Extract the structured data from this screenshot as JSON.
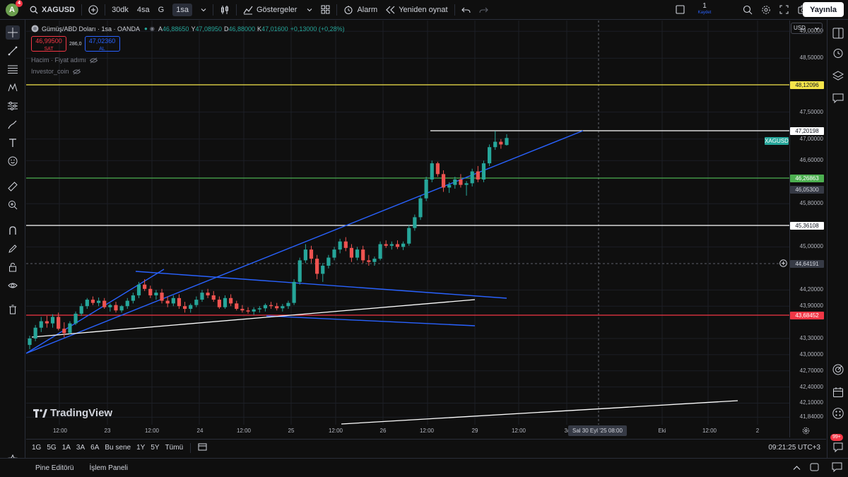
{
  "topbar": {
    "avatar_letter": "A",
    "avatar_badge": "4",
    "symbol": "XAGUSD",
    "intervals": [
      "30dk",
      "4sa",
      "G",
      "1sa"
    ],
    "indicators_label": "Göstergeler",
    "alarm_label": "Alarm",
    "replay_label": "Yeniden oynat",
    "save_count": "1",
    "save_label": "Kaydet",
    "publish_label": "Yayınla"
  },
  "legend": {
    "title": "Gümüş/ABD Doları · 1sa · OANDA",
    "open_key": "A",
    "open_value": "46,88650",
    "high_key": "Y",
    "high_value": "47,08950",
    "low_key": "D",
    "low_value": "46,88000",
    "close_key": "K",
    "close_value": "47,01600",
    "change": "+0,13000 (+0,28%)",
    "sell_price": "46,99500",
    "sell_label": "SAT",
    "spread": "286,0",
    "buy_price": "47,02360",
    "buy_label": "AL",
    "volume_label": "Hacim · Fiyat adımı",
    "investor_label": "Investor_coin"
  },
  "price_axis": {
    "currency": "USD",
    "labels": [
      "49,00000",
      "48,50000",
      "47,50000",
      "47,00000",
      "46,60000",
      "45,80000",
      "45,00000",
      "44,20000",
      "43,90000",
      "43,30000",
      "43,00000",
      "42,70000",
      "42,40000",
      "42,10000",
      "41,84000"
    ],
    "tags": [
      {
        "value": "48,12096",
        "color": "#f5e54a",
        "text": "#131722"
      },
      {
        "value": "47,20198",
        "color": "#ffffff",
        "text": "#131722"
      },
      {
        "value": "XAGUSD",
        "color": "#26a69a",
        "text": "#ffffff"
      },
      {
        "value": "46,26863",
        "color": "#4caf50",
        "text": "#ffffff"
      },
      {
        "value": "46,05300",
        "color": "#363a45",
        "text": "#d1d4dc"
      },
      {
        "value": "45,36108",
        "color": "#ffffff",
        "text": "#131722"
      },
      {
        "value": "44,64191",
        "color": "#363a45",
        "text": "#d1d4dc"
      },
      {
        "value": "43,68452",
        "color": "#f23645",
        "text": "#ffffff"
      }
    ]
  },
  "time_axis": {
    "labels": [
      "12:00",
      "23",
      "12:00",
      "24",
      "12:00",
      "25",
      "12:00",
      "26",
      "12:00",
      "29",
      "12:00",
      "3(",
      "Eki",
      "12:00",
      "2"
    ],
    "crosshair": "Sal 30 Eyl '25   08:00"
  },
  "watermark": "TradingView",
  "bottom": {
    "ranges": [
      "1G",
      "5G",
      "1A",
      "3A",
      "6A",
      "Bu sene",
      "1Y",
      "5Y",
      "Tümü"
    ],
    "clock": "09:21:25 UTC+3"
  },
  "footer": {
    "pine_label": "Pine Editörü",
    "panel_label": "İşlem Paneli",
    "notif_badge": "99+"
  },
  "chart_data": {
    "type": "candlestick",
    "symbol": "XAGUSD",
    "interval": "1sa",
    "price_levels": [
      48.12096,
      47.20198,
      46.26863,
      45.36108,
      43.68452
    ],
    "ylim": [
      41.7,
      49.2
    ],
    "candles": [
      [
        43.18,
        43.35,
        43.1,
        43.3
      ],
      [
        43.3,
        43.55,
        43.25,
        43.5
      ],
      [
        43.5,
        43.7,
        43.42,
        43.62
      ],
      [
        43.62,
        43.72,
        43.5,
        43.58
      ],
      [
        43.58,
        43.75,
        43.5,
        43.7
      ],
      [
        43.7,
        43.78,
        43.45,
        43.48
      ],
      [
        43.48,
        43.6,
        43.32,
        43.4
      ],
      [
        43.4,
        43.62,
        43.38,
        43.58
      ],
      [
        43.58,
        43.8,
        43.55,
        43.76
      ],
      [
        43.76,
        43.95,
        43.72,
        43.9
      ],
      [
        43.9,
        44.05,
        43.85,
        44.02
      ],
      [
        44.02,
        44.08,
        43.92,
        43.96
      ],
      [
        43.96,
        44.06,
        43.9,
        44.0
      ],
      [
        44.0,
        44.05,
        43.85,
        43.88
      ],
      [
        43.88,
        43.95,
        43.8,
        43.92
      ],
      [
        43.92,
        43.98,
        43.78,
        43.82
      ],
      [
        43.82,
        43.92,
        43.78,
        43.9
      ],
      [
        43.9,
        44.05,
        43.85,
        44.0
      ],
      [
        44.0,
        44.15,
        43.95,
        44.1
      ],
      [
        44.1,
        44.35,
        44.05,
        44.3
      ],
      [
        44.3,
        44.4,
        44.18,
        44.22
      ],
      [
        44.22,
        44.28,
        44.05,
        44.1
      ],
      [
        44.1,
        44.2,
        44.02,
        44.15
      ],
      [
        44.15,
        44.22,
        43.95,
        44.0
      ],
      [
        44.0,
        44.08,
        43.88,
        43.95
      ],
      [
        43.95,
        44.1,
        43.9,
        44.05
      ],
      [
        44.05,
        44.12,
        43.85,
        43.9
      ],
      [
        43.9,
        43.98,
        43.78,
        43.85
      ],
      [
        43.85,
        43.95,
        43.78,
        43.92
      ],
      [
        43.92,
        44.08,
        43.88,
        44.02
      ],
      [
        44.02,
        44.2,
        43.98,
        44.15
      ],
      [
        44.15,
        44.22,
        44.05,
        44.1
      ],
      [
        44.1,
        44.18,
        43.98,
        44.02
      ],
      [
        44.02,
        44.08,
        43.85,
        43.88
      ],
      [
        43.88,
        44.1,
        43.85,
        44.05
      ],
      [
        44.05,
        44.12,
        43.9,
        43.95
      ],
      [
        43.95,
        44.0,
        43.82,
        43.85
      ],
      [
        43.85,
        43.92,
        43.78,
        43.82
      ],
      [
        43.82,
        43.88,
        43.76,
        43.8
      ],
      [
        43.8,
        43.88,
        43.74,
        43.84
      ],
      [
        43.84,
        43.9,
        43.78,
        43.86
      ],
      [
        43.86,
        43.95,
        43.8,
        43.92
      ],
      [
        43.92,
        43.98,
        43.85,
        43.9
      ],
      [
        43.9,
        43.96,
        43.82,
        43.86
      ],
      [
        43.86,
        43.94,
        43.8,
        43.9
      ],
      [
        43.9,
        44.0,
        43.85,
        43.96
      ],
      [
        43.96,
        44.4,
        43.92,
        44.35
      ],
      [
        44.35,
        44.8,
        44.3,
        44.75
      ],
      [
        44.75,
        45.05,
        44.7,
        44.95
      ],
      [
        44.95,
        45.02,
        44.7,
        44.78
      ],
      [
        44.78,
        44.85,
        44.4,
        44.5
      ],
      [
        44.5,
        44.7,
        44.35,
        44.65
      ],
      [
        44.65,
        44.85,
        44.6,
        44.8
      ],
      [
        44.8,
        45.0,
        44.75,
        44.95
      ],
      [
        44.95,
        45.15,
        44.88,
        45.1
      ],
      [
        45.1,
        45.18,
        44.92,
        44.98
      ],
      [
        44.98,
        45.05,
        44.72,
        44.8
      ],
      [
        44.8,
        45.0,
        44.75,
        44.95
      ],
      [
        44.95,
        45.02,
        44.7,
        44.75
      ],
      [
        44.75,
        44.85,
        44.65,
        44.72
      ],
      [
        44.72,
        44.82,
        44.65,
        44.78
      ],
      [
        44.78,
        45.1,
        44.75,
        45.05
      ],
      [
        45.05,
        45.12,
        44.98,
        45.02
      ],
      [
        45.02,
        45.1,
        44.95,
        45.05
      ],
      [
        45.05,
        45.12,
        44.96,
        45.0
      ],
      [
        45.0,
        45.1,
        44.94,
        45.06
      ],
      [
        45.06,
        45.4,
        45.02,
        45.35
      ],
      [
        45.35,
        45.6,
        45.3,
        45.55
      ],
      [
        45.55,
        45.95,
        45.5,
        45.9
      ],
      [
        45.9,
        46.3,
        45.85,
        46.25
      ],
      [
        46.25,
        46.6,
        46.2,
        46.55
      ],
      [
        46.55,
        46.58,
        46.3,
        46.35
      ],
      [
        46.35,
        46.42,
        46.02,
        46.1
      ],
      [
        46.1,
        46.2,
        46.0,
        46.15
      ],
      [
        46.15,
        46.3,
        46.08,
        46.25
      ],
      [
        46.25,
        46.35,
        46.1,
        46.15
      ],
      [
        46.15,
        46.22,
        45.95,
        46.18
      ],
      [
        46.18,
        46.45,
        46.12,
        46.4
      ],
      [
        46.4,
        46.5,
        46.2,
        46.25
      ],
      [
        46.25,
        46.6,
        46.2,
        46.55
      ],
      [
        46.55,
        46.9,
        46.5,
        46.85
      ],
      [
        46.85,
        47.15,
        46.8,
        46.95
      ],
      [
        46.95,
        47.0,
        46.82,
        46.9
      ],
      [
        46.89,
        47.09,
        46.88,
        47.02
      ]
    ]
  }
}
